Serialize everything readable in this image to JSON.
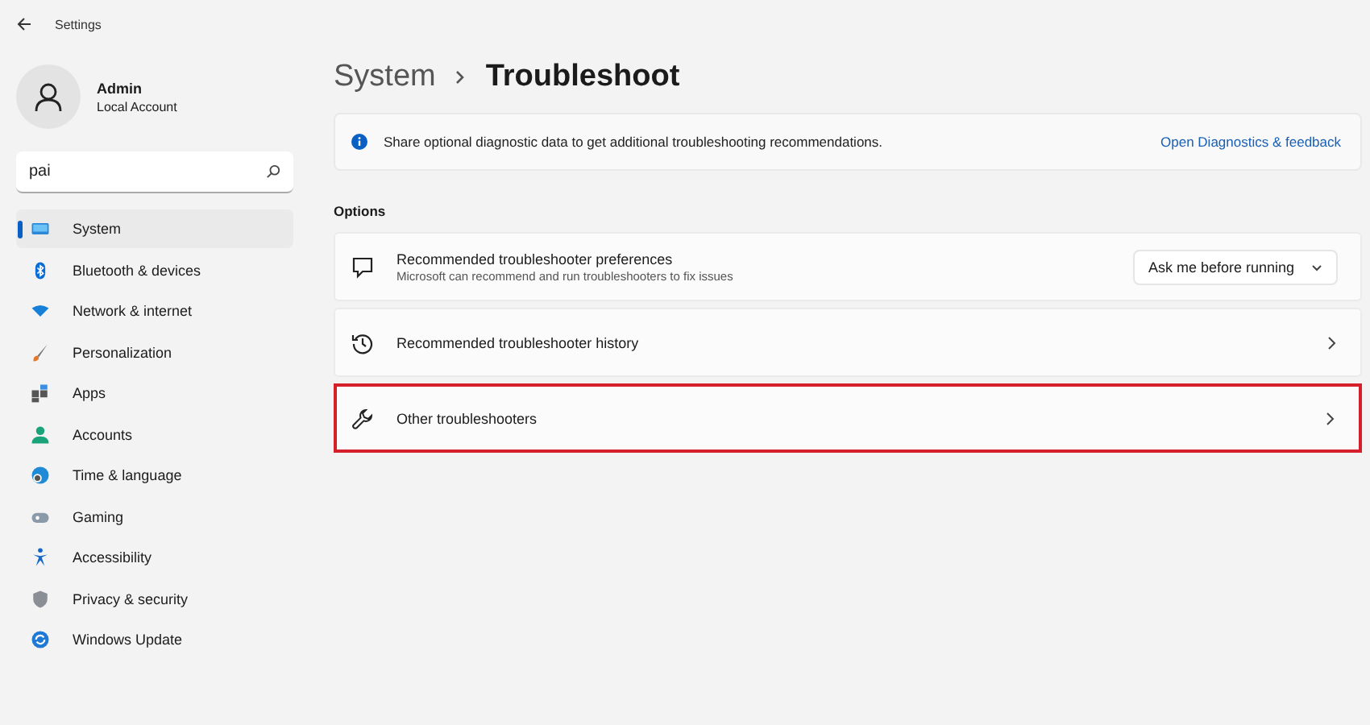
{
  "window": {
    "title": "Settings"
  },
  "account": {
    "name": "Admin",
    "type": "Local Account"
  },
  "search": {
    "value": "pai"
  },
  "sidebar": {
    "items": [
      {
        "label": "System",
        "selected": true
      },
      {
        "label": "Bluetooth & devices",
        "selected": false
      },
      {
        "label": "Network & internet",
        "selected": false
      },
      {
        "label": "Personalization",
        "selected": false
      },
      {
        "label": "Apps",
        "selected": false
      },
      {
        "label": "Accounts",
        "selected": false
      },
      {
        "label": "Time & language",
        "selected": false
      },
      {
        "label": "Gaming",
        "selected": false
      },
      {
        "label": "Accessibility",
        "selected": false
      },
      {
        "label": "Privacy & security",
        "selected": false
      },
      {
        "label": "Windows Update",
        "selected": false
      }
    ]
  },
  "breadcrumb": [
    "System",
    "Troubleshoot"
  ],
  "banner": {
    "text": "Share optional diagnostic data to get additional troubleshooting recommendations.",
    "link": "Open Diagnostics & feedback"
  },
  "section": "Options",
  "rows": [
    {
      "kind": "dropdown",
      "title": "Recommended troubleshooter preferences",
      "subtitle": "Microsoft can recommend and run troubleshooters to fix issues",
      "value": "Ask me before running",
      "highlighted": false
    },
    {
      "kind": "link",
      "title": "Recommended troubleshooter history",
      "highlighted": false
    },
    {
      "kind": "link",
      "title": "Other troubleshooters",
      "highlighted": true
    }
  ]
}
